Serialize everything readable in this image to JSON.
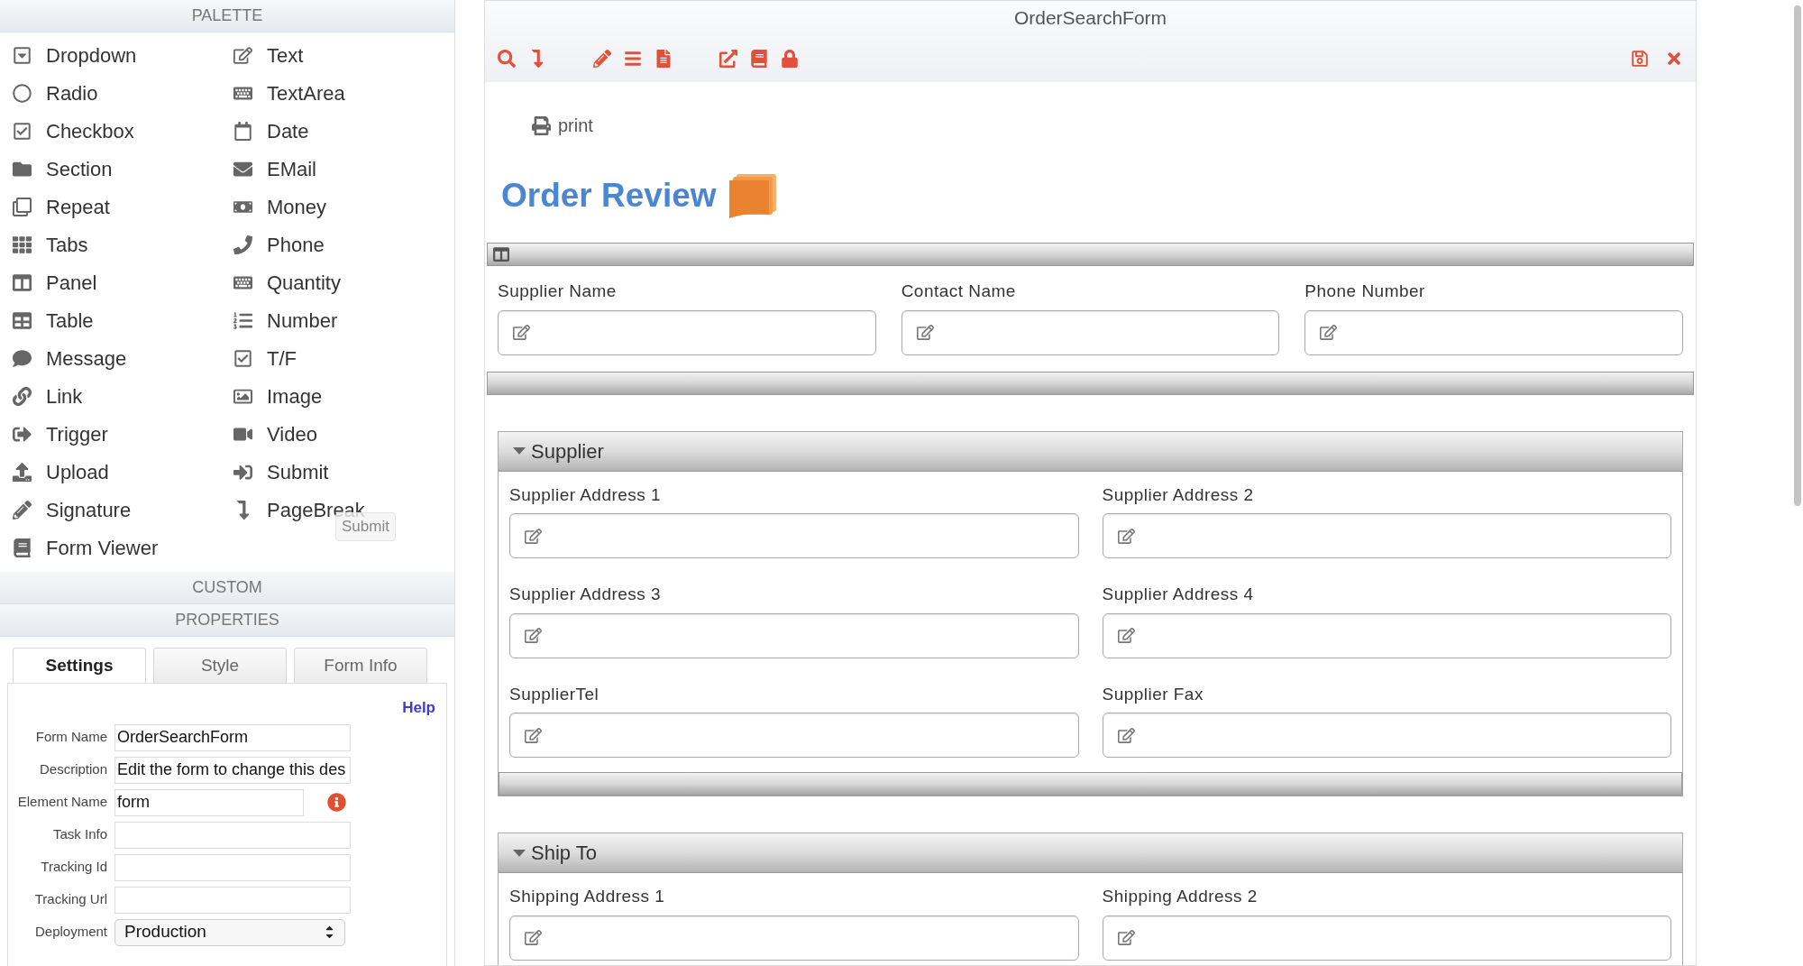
{
  "palette": {
    "title": "PALETTE",
    "columns": [
      {
        "items": [
          {
            "label": "Dropdown"
          },
          {
            "label": "Radio"
          },
          {
            "label": "Checkbox"
          },
          {
            "label": "Section"
          },
          {
            "label": "Repeat"
          },
          {
            "label": "Tabs"
          },
          {
            "label": "Panel"
          },
          {
            "label": "Table"
          },
          {
            "label": "Message"
          },
          {
            "label": "Link"
          },
          {
            "label": "Trigger"
          },
          {
            "label": "Upload"
          },
          {
            "label": "Signature"
          },
          {
            "label": "Form Viewer"
          }
        ]
      },
      {
        "items": [
          {
            "label": "Text"
          },
          {
            "label": "TextArea"
          },
          {
            "label": "Date"
          },
          {
            "label": "EMail"
          },
          {
            "label": "Money"
          },
          {
            "label": "Phone"
          },
          {
            "label": "Quantity"
          },
          {
            "label": "Number"
          },
          {
            "label": "T/F"
          },
          {
            "label": "Image"
          },
          {
            "label": "Video"
          },
          {
            "label": "Submit"
          },
          {
            "label": "PageBreak"
          }
        ]
      }
    ],
    "tooltip": "Submit"
  },
  "custom": {
    "title": "CUSTOM"
  },
  "properties": {
    "title": "PROPERTIES",
    "tabs": [
      {
        "label": "Settings",
        "selected": true
      },
      {
        "label": "Style",
        "selected": false
      },
      {
        "label": "Form Info",
        "selected": false
      }
    ],
    "help": "Help",
    "rows": [
      {
        "kind": "text",
        "label": "Form Name",
        "value": "OrderSearchForm",
        "info": false
      },
      {
        "kind": "text",
        "label": "Description",
        "value": "Edit the form to change this des",
        "info": false
      },
      {
        "kind": "text",
        "label": "Element Name",
        "value": "form",
        "info": true
      },
      {
        "kind": "text",
        "label": "Task Info",
        "info": false
      },
      {
        "kind": "text",
        "label": "Tracking Id",
        "info": false
      },
      {
        "kind": "text",
        "label": "Tracking Url",
        "info": false
      },
      {
        "kind": "select",
        "label": "Deployment",
        "value": "Production",
        "info": false
      }
    ]
  },
  "form": {
    "title": "OrderSearchForm",
    "print": "print",
    "heading": "Order Review",
    "top_fields": [
      {
        "label": "Supplier Name"
      },
      {
        "label": "Contact Name"
      },
      {
        "label": "Phone Number"
      }
    ],
    "sections": [
      {
        "title": "Supplier",
        "expanded": true,
        "fields": [
          {
            "label": "Supplier Address 1"
          },
          {
            "label": "Supplier Address 2"
          },
          {
            "label": "Supplier Address 3"
          },
          {
            "label": "Supplier Address 4"
          },
          {
            "label": "SupplierTel"
          },
          {
            "label": "Supplier Fax"
          }
        ]
      },
      {
        "title": "Ship To",
        "expanded": true,
        "fields": [
          {
            "label": "Shipping Address 1"
          },
          {
            "label": "Shipping Address 2"
          }
        ]
      }
    ]
  }
}
